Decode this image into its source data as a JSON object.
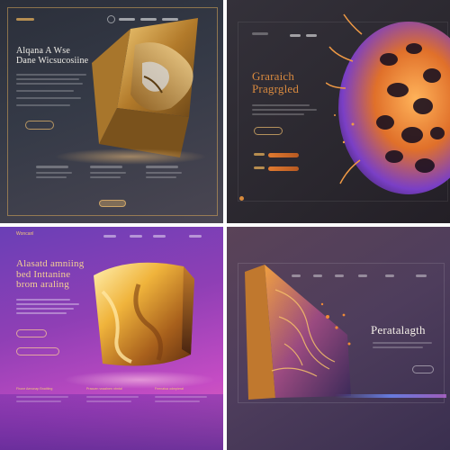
{
  "panels": [
    {
      "heading": "Alqana A Wse\nDane Wicsucosiine"
    },
    {
      "heading": "Graraich\nPragrgled"
    },
    {
      "heading": "Alasatd amniing\nbed Inttanine\nbrom araling",
      "brand": "Woncanl",
      "columns": [
        "Fhone Aenonap Bnatiting",
        "Pracuen vnaalnen ntmtal",
        "Feenatoa odmpieral"
      ]
    },
    {
      "heading": "Peratalagth"
    }
  ],
  "colors": {
    "gold": "#e0a848",
    "violet": "#7b3fc6",
    "magenta": "#d14fc0",
    "orange": "#f08a36"
  },
  "icons": [
    "gear-icon",
    "circle-dot-icon"
  ]
}
